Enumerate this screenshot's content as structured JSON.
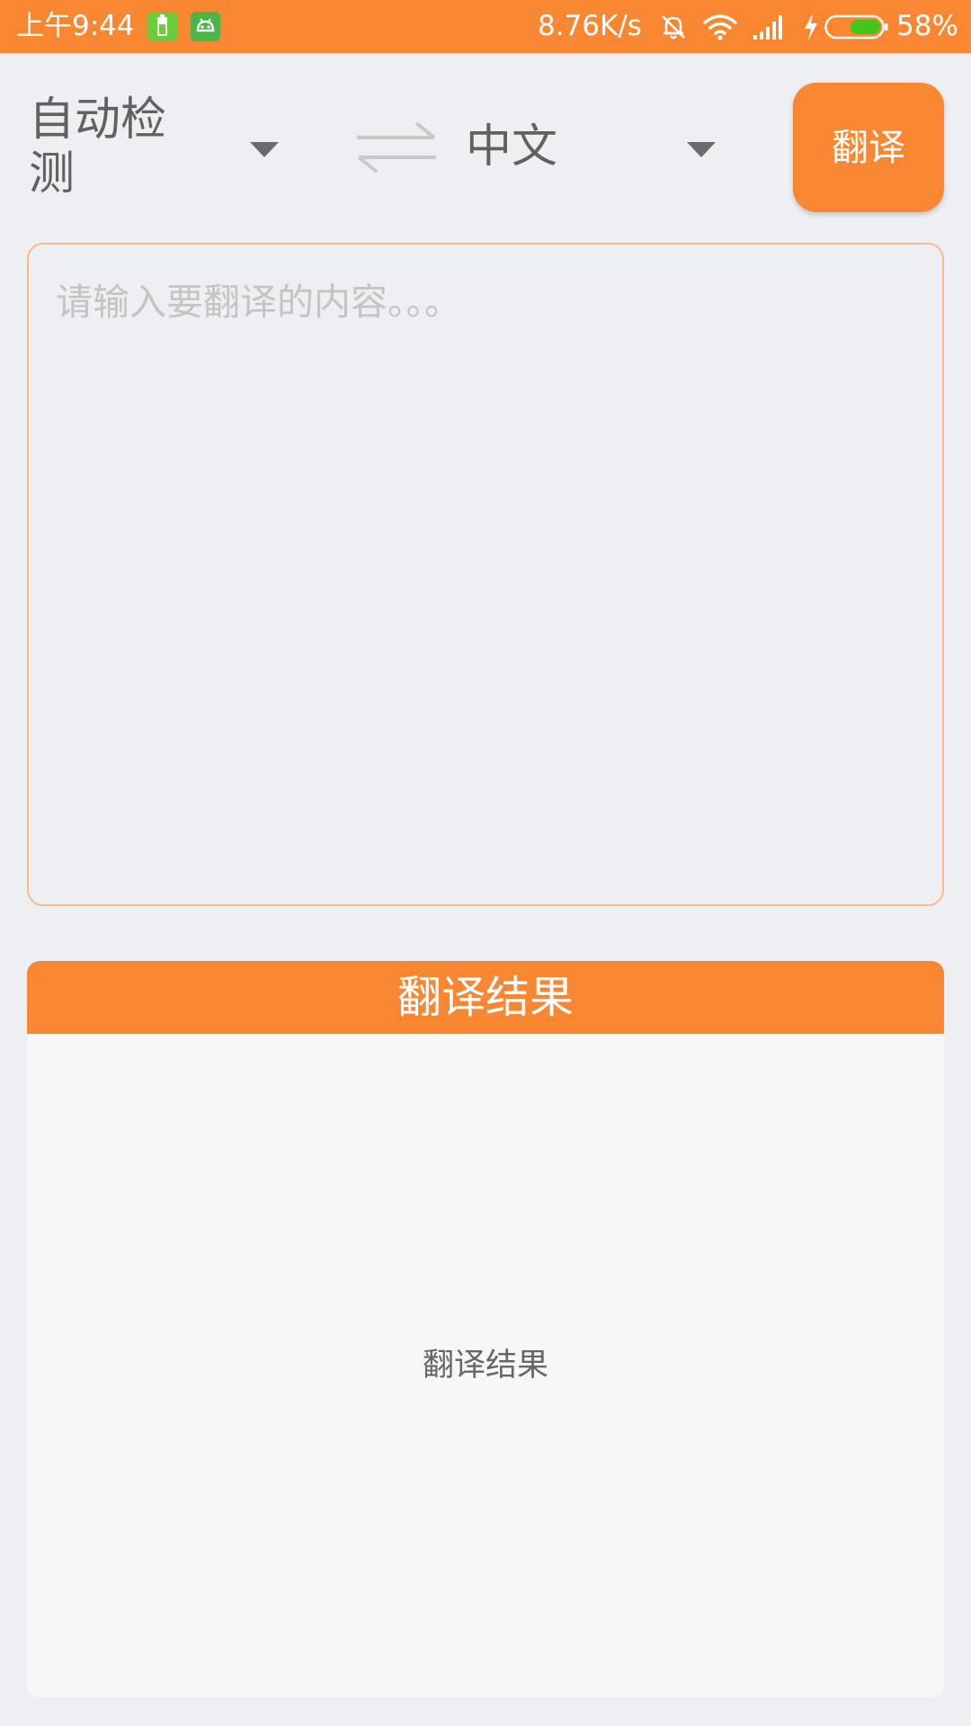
{
  "status_bar": {
    "time": "上午9:44",
    "network_speed": "8.76K/s",
    "battery_percent": "58%",
    "icons": [
      "battery-app-icon",
      "android-app-icon",
      "mute-bell-icon",
      "wifi-icon",
      "signal-icon",
      "charging-icon",
      "battery-icon"
    ]
  },
  "toolbar": {
    "source_language": "自动检测",
    "target_language": "中文",
    "swap_icon": "swap-arrows-icon",
    "translate_label": "翻译"
  },
  "input": {
    "value": "",
    "placeholder": "请输入要翻译的内容。。。"
  },
  "result": {
    "header": "翻译结果",
    "text": "翻译结果"
  },
  "colors": {
    "accent": "#f98631",
    "background": "#eeeff2",
    "input_border": "#f7b98c",
    "result_background": "#f7f7f8"
  }
}
